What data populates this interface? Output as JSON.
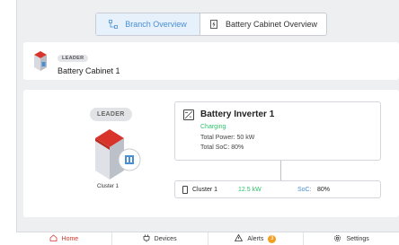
{
  "tabs": [
    {
      "label": "Branch Overview",
      "icon": "branch-icon",
      "active": true
    },
    {
      "label": "Battery Cabinet Overview",
      "icon": "cabinet-icon",
      "active": false
    }
  ],
  "leader_card": {
    "badge": "LEADER",
    "title": "Battery Cabinet 1"
  },
  "topology": {
    "leader_pill": "LEADER",
    "cluster_label": "Cluster 1",
    "inverter": {
      "title": "Battery Inverter 1",
      "status": "Charging",
      "total_power": "Total Power: 50 kW",
      "total_soc": "Total SoC: 80%"
    },
    "cluster_row": {
      "name": "Cluster 1",
      "power": "12.5 kW",
      "soc_label": "SoC:",
      "soc_value": "80%"
    }
  },
  "nav": {
    "home": "Home",
    "devices": "Devices",
    "alerts": "Alerts",
    "alerts_count": "3",
    "settings": "Settings"
  },
  "colors": {
    "accent_blue": "#4a8fd6",
    "status_green": "#2fc26b",
    "nav_active_red": "#d9342b",
    "badge_orange": "#f0a020"
  }
}
